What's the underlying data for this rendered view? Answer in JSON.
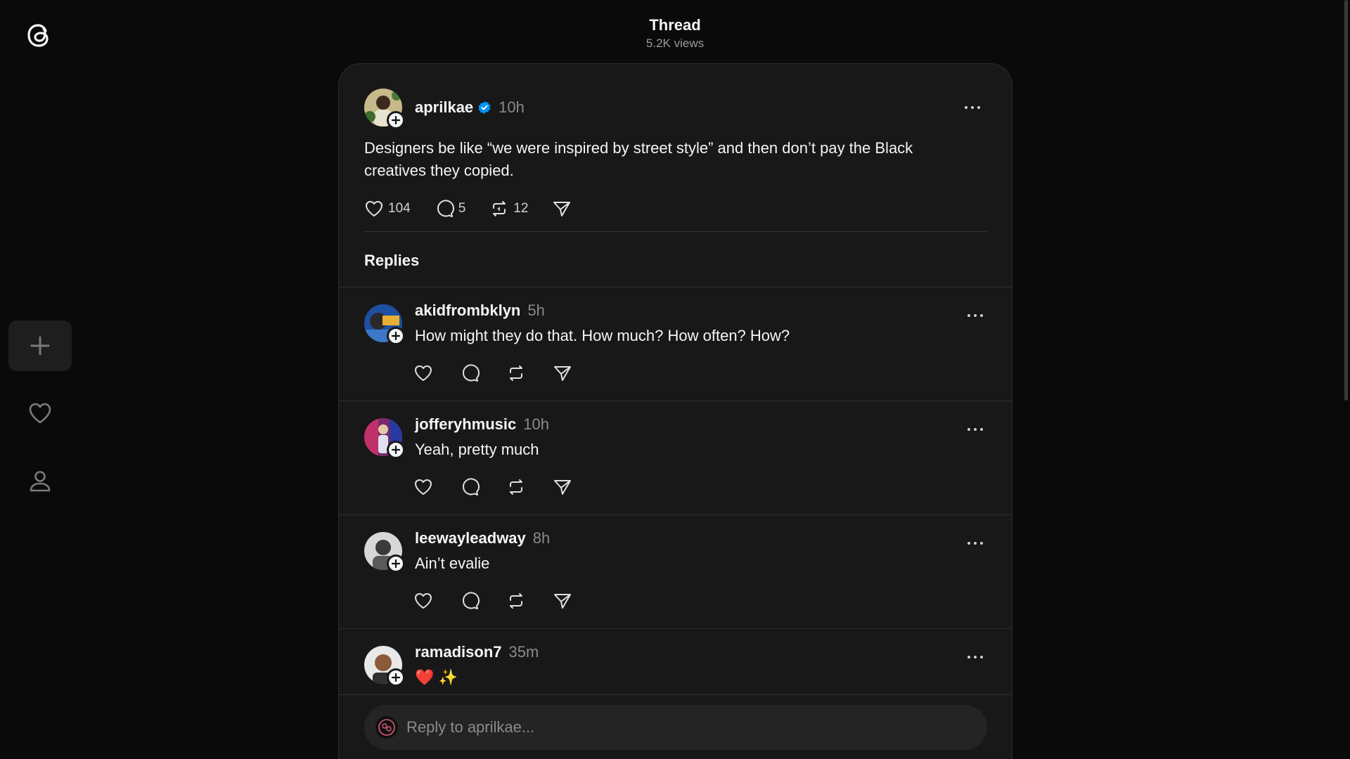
{
  "header": {
    "title": "Thread",
    "views": "5.2K views"
  },
  "nav": {
    "logo_icon": "threads-logo-icon",
    "items": [
      "create-icon",
      "heart-icon",
      "profile-icon"
    ]
  },
  "main_post": {
    "username": "aprilkae",
    "verified": true,
    "time": "10h",
    "text": "Designers be like “we were inspired by street style” and then don’t pay the Black creatives they copied.",
    "likes": "104",
    "comments": "5",
    "reposts": "12"
  },
  "replies_title": "Replies",
  "replies": [
    {
      "username": "akidfrombklyn",
      "time": "5h",
      "text": "How might they do that. How much? How often? How?"
    },
    {
      "username": "jofferyhmusic",
      "time": "10h",
      "text": "Yeah, pretty much"
    },
    {
      "username": "leewayleadway",
      "time": "8h",
      "text": "Ain’t evalie"
    },
    {
      "username": "ramadison7",
      "time": "35m",
      "text": "❤️ ✨"
    }
  ],
  "composer": {
    "placeholder": "Reply to aprilkae..."
  },
  "colors": {
    "background": "#0a0a0a",
    "panel": "#181818",
    "verified": "#0095f6",
    "muted": "#8a8a8a"
  }
}
